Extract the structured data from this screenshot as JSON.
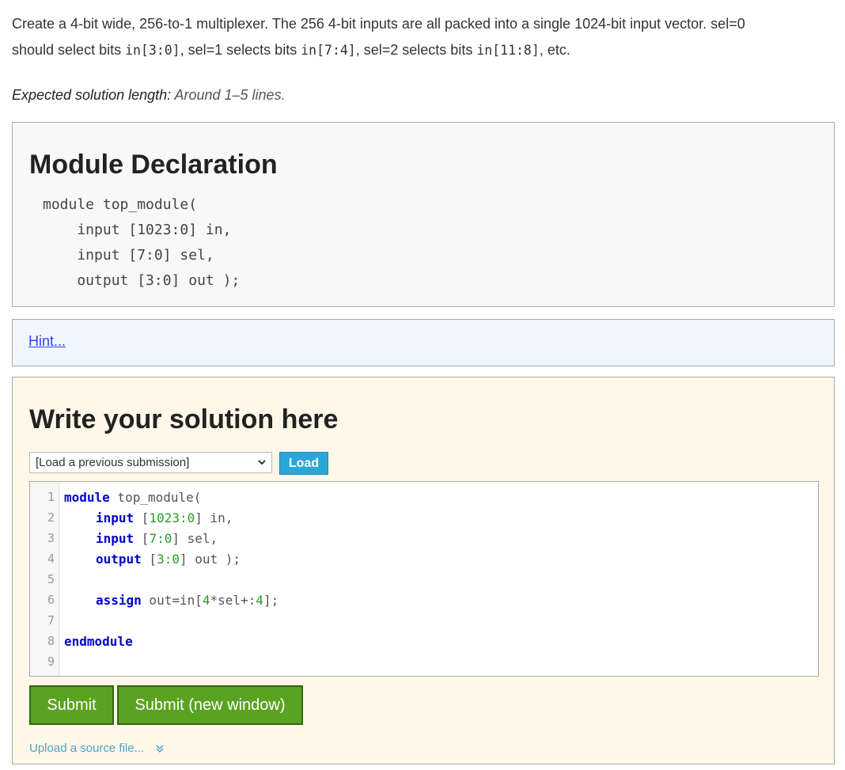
{
  "intro": {
    "text1": "Create a 4-bit wide, 256-to-1 multiplexer. The 256 4-bit inputs are all packed into a single 1024-bit input vector. sel=0",
    "text2a": "should select bits ",
    "code1": "in[3:0]",
    "text2b": ", sel=1 selects bits ",
    "code2": "in[7:4]",
    "text2c": ", sel=2 selects bits ",
    "code3": "in[11:8]",
    "text2d": ", etc."
  },
  "expected": {
    "label": "Expected solution length:",
    "value": " Around 1–5 lines."
  },
  "declaration": {
    "title": "Module Declaration",
    "code": "module top_module( \n    input [1023:0] in,\n    input [7:0] sel,\n    output [3:0] out );"
  },
  "hint": {
    "label": "Hint..."
  },
  "solution": {
    "title": "Write your solution here",
    "select_value": "[Load a previous submission]",
    "load_label": "Load",
    "line_numbers": [
      "1",
      "2",
      "3",
      "4",
      "5",
      "6",
      "7",
      "8",
      "9"
    ],
    "submit_label": "Submit",
    "submit_new_label": "Submit (new window)",
    "upload_label": "Upload a source file...",
    "code": {
      "l1_kw": "module",
      "l1_rest": " top_module(",
      "l2_kw": "input",
      "l2_a": " [",
      "l2_num": "1023:0",
      "l2_b": "] in,",
      "l3_kw": "input",
      "l3_a": " [",
      "l3_num": "7:0",
      "l3_b": "] sel,",
      "l4_kw": "output",
      "l4_a": " [",
      "l4_num": "3:0",
      "l4_b": "] out );",
      "l6_kw": "assign",
      "l6_a": " out=in[",
      "l6_num": "4",
      "l6_b": "*sel+:",
      "l6_num2": "4",
      "l6_c": "];",
      "l8_kw": "endmodule"
    }
  }
}
